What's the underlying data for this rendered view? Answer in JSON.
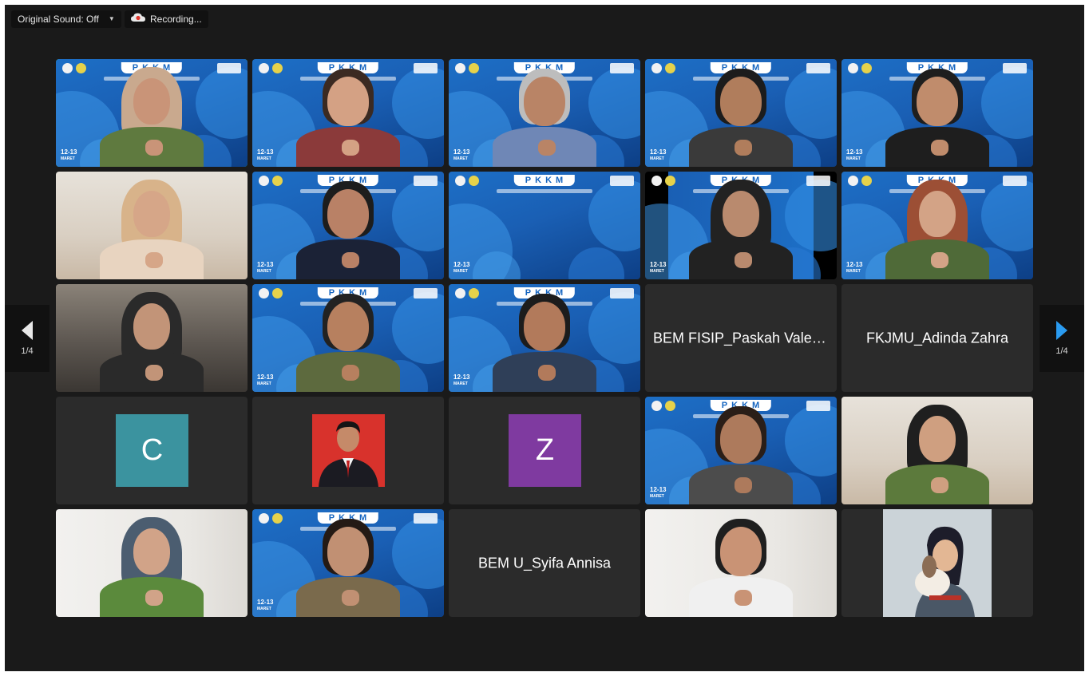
{
  "toolbar": {
    "original_sound_label": "Original Sound: Off",
    "recording_label": "Recording..."
  },
  "pagination": {
    "prev_page_label": "1/4",
    "next_page_label": "1/4"
  },
  "virtual_background": {
    "brand": "PKKM",
    "date_day": "12-13",
    "date_month": "MARET"
  },
  "participants": [
    {
      "type": "video",
      "bg": "pkmm",
      "style": "hijab",
      "hijab": "#c9a98e",
      "skin": "#c99478",
      "clothes": "#5f7a3f",
      "active": true
    },
    {
      "type": "video",
      "bg": "pkmm",
      "style": "hair",
      "hair": "#3b2a22",
      "skin": "#d4a184",
      "clothes": "#8b3a3a"
    },
    {
      "type": "video",
      "bg": "pkmm",
      "style": "hair",
      "hair": "#bdbdbd",
      "skin": "#b98466",
      "clothes": "#6f87b6"
    },
    {
      "type": "video",
      "bg": "pkmm",
      "style": "hair",
      "hair": "#1c1c1c",
      "skin": "#b07d5c",
      "clothes": "#3a3a3a"
    },
    {
      "type": "video",
      "bg": "pkmm",
      "style": "hair",
      "hair": "#1e1e1e",
      "skin": "#c08c6c",
      "clothes": "#1e1e1e"
    },
    {
      "type": "video",
      "bg": "room-light",
      "style": "hijab",
      "hijab": "#d8b38a",
      "skin": "#d6a688",
      "clothes": "#e8d4c0"
    },
    {
      "type": "video",
      "bg": "pkmm",
      "style": "hair",
      "hair": "#1d1d1d",
      "skin": "#b98166",
      "clothes": "#1b2236"
    },
    {
      "type": "video",
      "bg": "pkmm",
      "style": "none"
    },
    {
      "type": "video",
      "bg": "pkmm-dark",
      "style": "hijab",
      "hijab": "#222222",
      "skin": "#b98a6e",
      "clothes": "#222222"
    },
    {
      "type": "video",
      "bg": "pkmm",
      "style": "hijab",
      "hijab": "#9c4f35",
      "skin": "#d3a386",
      "clothes": "#4f6a38"
    },
    {
      "type": "video",
      "bg": "room-dark",
      "style": "hijab",
      "hijab": "#2a2a2a",
      "skin": "#c29478",
      "clothes": "#2a2a2a"
    },
    {
      "type": "video",
      "bg": "pkmm",
      "style": "hair",
      "hair": "#222222",
      "skin": "#b7805f",
      "clothes": "#5d6a3e"
    },
    {
      "type": "video",
      "bg": "pkmm",
      "style": "hair",
      "hair": "#1c1c1c",
      "skin": "#b27a5b",
      "clothes": "#2f3f58"
    },
    {
      "type": "name",
      "name": "BEM FISIP_Paskah Valen..."
    },
    {
      "type": "name",
      "name": "FKJMU_Adinda Zahra"
    },
    {
      "type": "avatar",
      "letter": "C",
      "color": "#3b939f"
    },
    {
      "type": "photo"
    },
    {
      "type": "avatar",
      "letter": "Z",
      "color": "#7f3aa0"
    },
    {
      "type": "video",
      "bg": "pkmm",
      "style": "hair",
      "hair": "#2a1e18",
      "skin": "#ad7a5c",
      "clothes": "#4c4c4c"
    },
    {
      "type": "video",
      "bg": "room-light",
      "style": "hijab",
      "hijab": "#1f1f1f",
      "skin": "#cf9f80",
      "clothes": "#5c7a3c"
    },
    {
      "type": "video",
      "bg": "room-white",
      "style": "hijab",
      "hijab": "#4b5d70",
      "skin": "#d1a388",
      "clothes": "#5b8a3c"
    },
    {
      "type": "video",
      "bg": "pkmm",
      "style": "hair",
      "hair": "#241a15",
      "skin": "#c19073",
      "clothes": "#7a6a4c"
    },
    {
      "type": "name",
      "name": "BEM U_Syifa Annisa"
    },
    {
      "type": "video",
      "bg": "room-white",
      "style": "hair",
      "hair": "#1f1f1f",
      "skin": "#c99375",
      "clothes": "#f0f0f0"
    },
    {
      "type": "cartoon"
    }
  ],
  "colors": {
    "active_speaker": "#2dc63f",
    "tile_bg": "#2b2b2b",
    "meeting_bg": "#1a1a1a"
  },
  "icons": {
    "recording": "cloud-recording-icon",
    "prev": "arrow-left-icon",
    "next": "arrow-right-icon"
  }
}
